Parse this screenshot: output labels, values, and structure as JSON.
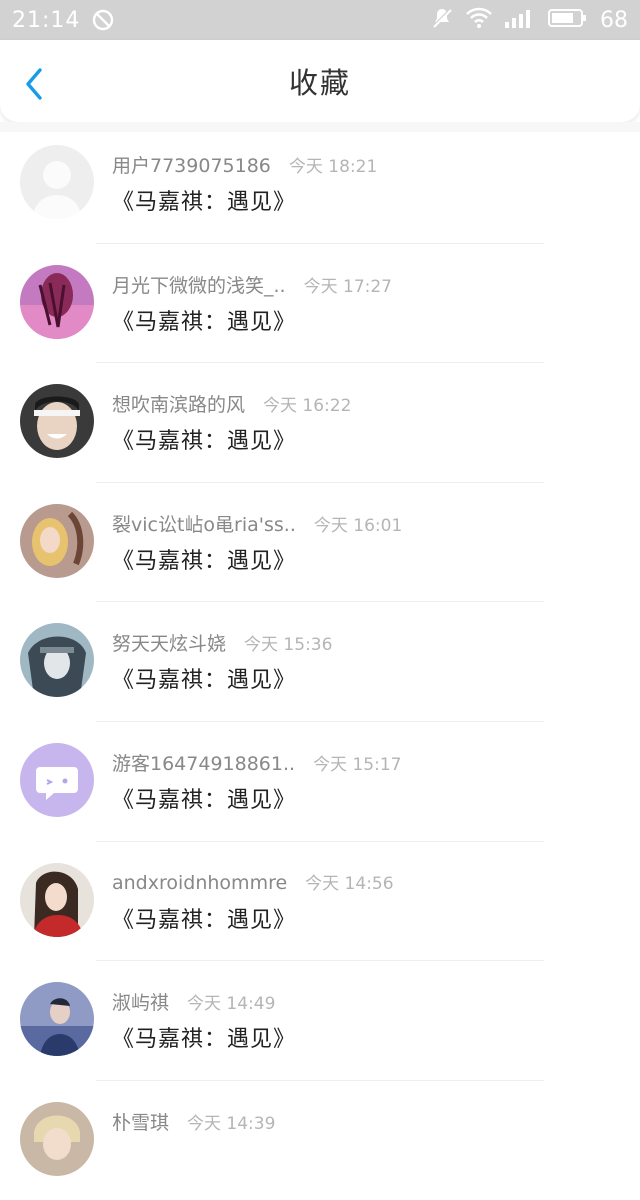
{
  "status": {
    "time": "21:14",
    "battery": "68"
  },
  "header": {
    "title": "收藏"
  },
  "items": [
    {
      "user": "用户7739075186",
      "time": "今天 18:21",
      "book": "《马嘉祺：遇见》"
    },
    {
      "user": "月光下微微的浅笑_..",
      "time": "今天 17:27",
      "book": "《马嘉祺：遇见》"
    },
    {
      "user": "想吹南滨路的风",
      "time": "今天 16:22",
      "book": "《马嘉祺：遇见》"
    },
    {
      "user": "裂vic讼t岾o黾ria'ss..",
      "time": "今天 16:01",
      "book": "《马嘉祺：遇见》"
    },
    {
      "user": "努天天炫斗娆",
      "time": "今天 15:36",
      "book": "《马嘉祺：遇见》"
    },
    {
      "user": "游客16474918861..",
      "time": "今天 15:17",
      "book": "《马嘉祺：遇见》"
    },
    {
      "user": "andxroidnhommre",
      "time": "今天 14:56",
      "book": "《马嘉祺：遇见》"
    },
    {
      "user": "淑屿祺",
      "time": "今天 14:49",
      "book": "《马嘉祺：遇见》"
    },
    {
      "user": "朴雪琪",
      "time": "今天 14:39",
      "book": ""
    }
  ],
  "colors": {
    "accent": "#1a9be8",
    "statusbar": "#d2d2d2"
  }
}
